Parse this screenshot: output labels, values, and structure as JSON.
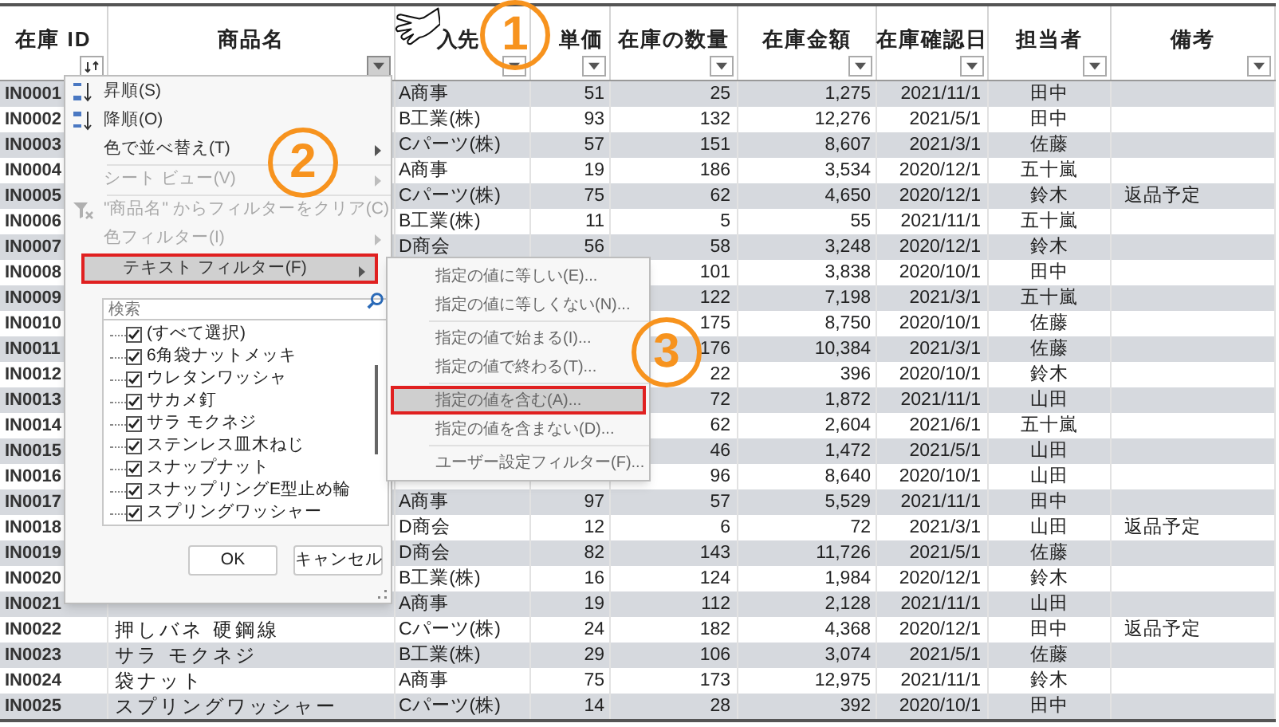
{
  "table": {
    "columns": [
      {
        "label": "在庫 ID",
        "kind": "sorted",
        "active": false
      },
      {
        "label": "商品名",
        "kind": "plain",
        "active": true
      },
      {
        "label": "入先",
        "kind": "plain",
        "active": false
      },
      {
        "label": "単価",
        "kind": "plain",
        "active": false
      },
      {
        "label": "在庫の数量",
        "kind": "plain",
        "active": false
      },
      {
        "label": "在庫金額",
        "kind": "plain",
        "active": false
      },
      {
        "label": "在庫確認日",
        "kind": "plain",
        "active": false
      },
      {
        "label": "担当者",
        "kind": "plain",
        "active": false
      },
      {
        "label": "備考",
        "kind": "plain",
        "active": false
      }
    ],
    "rows": [
      {
        "id": "IN0001",
        "supplier": "A商事",
        "price": "51",
        "qty": "25",
        "amount": "1,275",
        "date": "2021/11/1",
        "staff": "田中"
      },
      {
        "id": "IN0002",
        "supplier": "B工業(株)",
        "price": "93",
        "qty": "132",
        "amount": "12,276",
        "date": "2021/5/1",
        "staff": "田中"
      },
      {
        "id": "IN0003",
        "supplier": "Cパーツ(株)",
        "price": "57",
        "qty": "151",
        "amount": "8,607",
        "date": "2021/3/1",
        "staff": "佐藤"
      },
      {
        "id": "IN0004",
        "supplier": "A商事",
        "price": "19",
        "qty": "186",
        "amount": "3,534",
        "date": "2020/12/1",
        "staff": "五十嵐"
      },
      {
        "id": "IN0005",
        "supplier": "Cパーツ(株)",
        "price": "75",
        "qty": "62",
        "amount": "4,650",
        "date": "2020/12/1",
        "staff": "鈴木",
        "note": "返品予定"
      },
      {
        "id": "IN0006",
        "supplier": "B工業(株)",
        "price": "11",
        "qty": "5",
        "amount": "55",
        "date": "2021/11/1",
        "staff": "五十嵐"
      },
      {
        "id": "IN0007",
        "supplier": "D商会",
        "price": "56",
        "qty": "58",
        "amount": "3,248",
        "date": "2020/12/1",
        "staff": "鈴木"
      },
      {
        "id": "IN0008",
        "qty": "101",
        "amount": "3,838",
        "date": "2020/10/1",
        "staff": "田中"
      },
      {
        "id": "IN0009",
        "qty": "122",
        "amount": "7,198",
        "date": "2021/3/1",
        "staff": "五十嵐"
      },
      {
        "id": "IN0010",
        "qty": "175",
        "amount": "8,750",
        "date": "2020/10/1",
        "staff": "佐藤"
      },
      {
        "id": "IN0011",
        "qty": "176",
        "amount": "10,384",
        "date": "2021/3/1",
        "staff": "佐藤"
      },
      {
        "id": "IN0012",
        "qty": "22",
        "amount": "396",
        "date": "2020/10/1",
        "staff": "鈴木"
      },
      {
        "id": "IN0013",
        "qty": "72",
        "amount": "1,872",
        "date": "2021/11/1",
        "staff": "山田"
      },
      {
        "id": "IN0014",
        "qty": "62",
        "amount": "2,604",
        "date": "2021/6/1",
        "staff": "五十嵐"
      },
      {
        "id": "IN0015",
        "qty": "46",
        "amount": "1,472",
        "date": "2021/5/1",
        "staff": "山田"
      },
      {
        "id": "IN0016",
        "qty": "96",
        "amount": "8,640",
        "date": "2020/10/1",
        "staff": "山田"
      },
      {
        "id": "IN0017",
        "supplier": "A商事",
        "price": "97",
        "qty": "57",
        "amount": "5,529",
        "date": "2021/11/1",
        "staff": "田中"
      },
      {
        "id": "IN0018",
        "supplier": "D商会",
        "price": "12",
        "qty": "6",
        "amount": "72",
        "date": "2021/3/1",
        "staff": "山田",
        "note": "返品予定"
      },
      {
        "id": "IN0019",
        "supplier": "D商会",
        "price": "82",
        "qty": "143",
        "amount": "11,726",
        "date": "2021/5/1",
        "staff": "佐藤"
      },
      {
        "id": "IN0020",
        "supplier": "B工業(株)",
        "price": "16",
        "qty": "124",
        "amount": "1,984",
        "date": "2020/12/1",
        "staff": "鈴木"
      },
      {
        "id": "IN0021",
        "supplier": "A商事",
        "price": "19",
        "qty": "112",
        "amount": "2,128",
        "date": "2021/11/1",
        "staff": "山田"
      },
      {
        "id": "IN0022",
        "name": "押しバネ 硬鋼線",
        "supplier": "Cパーツ(株)",
        "price": "24",
        "qty": "182",
        "amount": "4,368",
        "date": "2020/12/1",
        "staff": "田中",
        "note": "返品予定"
      },
      {
        "id": "IN0023",
        "name": "サラ モクネジ",
        "supplier": "B工業(株)",
        "price": "29",
        "qty": "106",
        "amount": "3,074",
        "date": "2021/5/1",
        "staff": "佐藤"
      },
      {
        "id": "IN0024",
        "name": "袋ナット",
        "supplier": "A商事",
        "price": "75",
        "qty": "173",
        "amount": "12,975",
        "date": "2021/11/1",
        "staff": "鈴木"
      },
      {
        "id": "IN0025",
        "name": "スプリングワッシャー",
        "supplier": "Cパーツ(株)",
        "price": "14",
        "qty": "28",
        "amount": "392",
        "date": "2020/10/1",
        "staff": "田中"
      }
    ]
  },
  "filter_menu": {
    "items": [
      {
        "label": "昇順(S)",
        "kind": "sort_asc",
        "disabled": false,
        "has_submenu": false,
        "separator_before": false,
        "selected": false
      },
      {
        "label": "降順(O)",
        "kind": "sort_desc",
        "disabled": false,
        "has_submenu": false,
        "separator_before": false,
        "selected": false
      },
      {
        "label": "色で並べ替え(T)",
        "kind": "plain",
        "disabled": false,
        "has_submenu": true,
        "separator_before": false,
        "selected": false
      },
      {
        "label": "シート ビュー(V)",
        "kind": "plain",
        "disabled": true,
        "has_submenu": true,
        "separator_before": true,
        "selected": false
      },
      {
        "label": "\"商品名\" からフィルターをクリア(C)",
        "kind": "clear_filter",
        "disabled": true,
        "has_submenu": false,
        "separator_before": true,
        "selected": false
      },
      {
        "label": "色フィルター(I)",
        "kind": "plain",
        "disabled": true,
        "has_submenu": true,
        "separator_before": false,
        "selected": false
      },
      {
        "label": "テキスト フィルター(F)",
        "kind": "plain",
        "disabled": false,
        "has_submenu": true,
        "separator_before": false,
        "selected": true
      }
    ],
    "search": {
      "placeholder": "検索"
    },
    "values": [
      {
        "label": "(すべて選択)",
        "checked": true
      },
      {
        "label": "6角袋ナットメッキ",
        "checked": true
      },
      {
        "label": "ウレタンワッシャ",
        "checked": true
      },
      {
        "label": "サカメ釘",
        "checked": true
      },
      {
        "label": "サラ モクネジ",
        "checked": true
      },
      {
        "label": "ステンレス皿木ねじ",
        "checked": true
      },
      {
        "label": "スナップナット",
        "checked": true
      },
      {
        "label": "スナップリングE型止め輪",
        "checked": true
      },
      {
        "label": "スプリングワッシャー",
        "checked": true
      }
    ],
    "buttons": [
      "OK",
      "キャンセル"
    ]
  },
  "text_filter_menu": {
    "items": [
      {
        "label": "指定の値に等しい(E)...",
        "separator_before": false,
        "selected": false
      },
      {
        "label": "指定の値に等しくない(N)...",
        "separator_before": false,
        "selected": false
      },
      {
        "label": "指定の値で始まる(I)...",
        "separator_before": true,
        "selected": false
      },
      {
        "label": "指定の値で終わる(T)...",
        "separator_before": false,
        "selected": false
      },
      {
        "label": "指定の値を含む(A)...",
        "separator_before": true,
        "selected": true
      },
      {
        "label": "指定の値を含まない(D)...",
        "separator_before": false,
        "selected": false
      },
      {
        "label": "ユーザー設定フィルター(F)...",
        "separator_before": true,
        "selected": false
      }
    ]
  },
  "annotations": [
    {
      "label": "1"
    },
    {
      "label": "2"
    },
    {
      "label": "3"
    }
  ]
}
